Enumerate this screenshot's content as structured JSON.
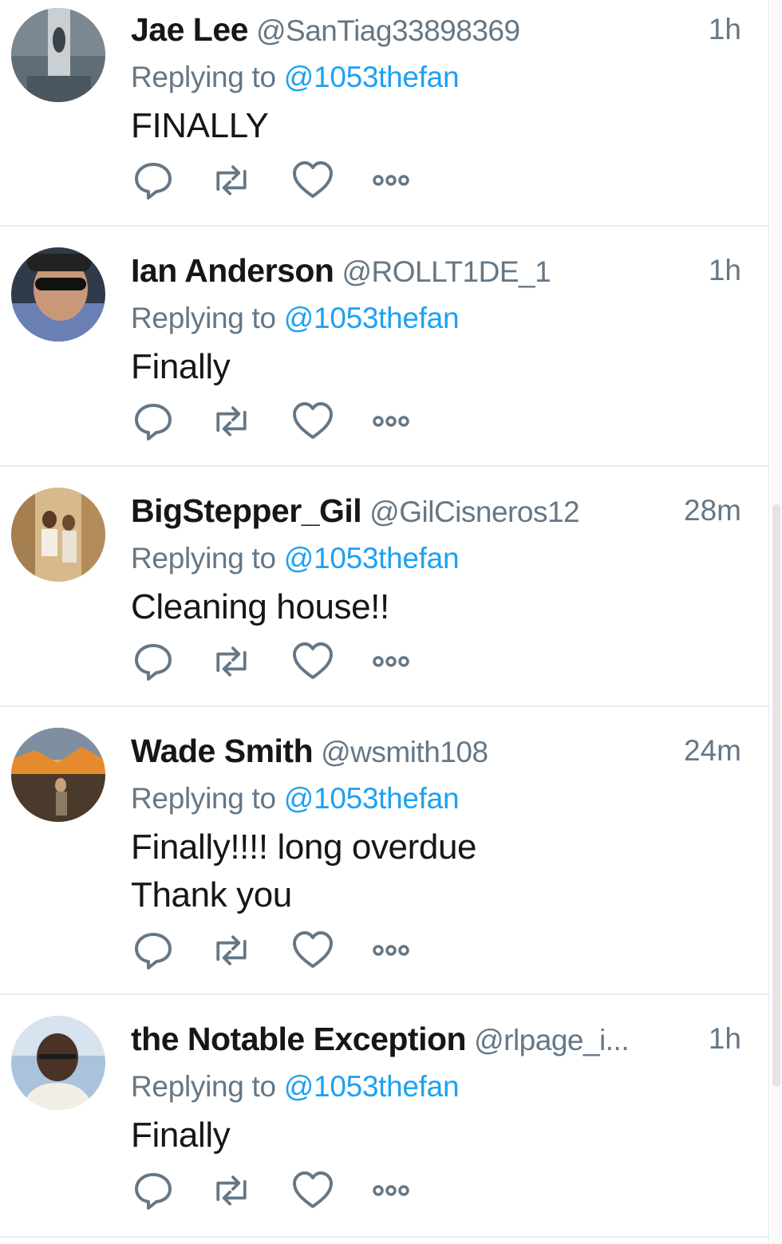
{
  "tweets": [
    {
      "name": "Jae Lee",
      "handle": "@SanTiag33898369",
      "time": "1h",
      "replying_prefix": "Replying to ",
      "replying_to": "@1053thefan",
      "text": "FINALLY",
      "avatar_colors": [
        "#5b6770",
        "#9aa4ab",
        "#e8e8e8"
      ]
    },
    {
      "name": "Ian Anderson",
      "handle": "@ROLLT1DE_1",
      "time": "1h",
      "replying_prefix": "Replying to ",
      "replying_to": "@1053thefan",
      "text": "Finally",
      "avatar_colors": [
        "#3d4a5c",
        "#c79a7c",
        "#6a7fb0"
      ]
    },
    {
      "name": "BigStepper_Gil",
      "handle": "@GilCisneros12",
      "time": "28m",
      "replying_prefix": "Replying to ",
      "replying_to": "@1053thefan",
      "text": "Cleaning house!!",
      "avatar_colors": [
        "#c9a46e",
        "#8a6a45",
        "#f3e2c4"
      ]
    },
    {
      "name": "Wade Smith",
      "handle": "@wsmith108",
      "time": "24m",
      "replying_prefix": "Replying to ",
      "replying_to": "@1053thefan",
      "text": "Finally!!!! long overdue\nThank you",
      "avatar_colors": [
        "#e58b2d",
        "#5c4a3a",
        "#f6c26b"
      ]
    },
    {
      "name": "the Notable Exception",
      "handle": "@rlpage_i...",
      "time": "1h",
      "replying_prefix": "Replying to ",
      "replying_to": "@1053thefan",
      "text": "Finally",
      "avatar_colors": [
        "#7fa3c8",
        "#4a3326",
        "#e9eef3"
      ]
    }
  ],
  "action_icons": [
    "reply-icon",
    "retweet-icon",
    "like-icon",
    "more-icon"
  ],
  "colors": {
    "link": "#1da1f2",
    "secondary_text": "#657786",
    "primary_text": "#14171a",
    "icon": "#657786",
    "divider": "#e6ecf0"
  }
}
